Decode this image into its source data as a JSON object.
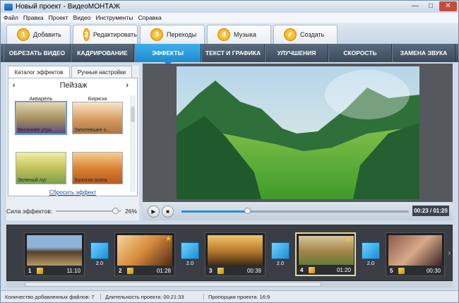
{
  "window": {
    "title": "Новый проект - ВидеоМОНТАЖ",
    "min": "—",
    "max": "□",
    "close": "✕"
  },
  "menu": [
    "Файл",
    "Правка",
    "Проект",
    "Видео",
    "Инструменты",
    "Справка"
  ],
  "steps": [
    {
      "num": "1",
      "label": "Добавить"
    },
    {
      "num": "2",
      "label": "Редактировать"
    },
    {
      "num": "3",
      "label": "Переходы"
    },
    {
      "num": "4",
      "label": "Музыка"
    },
    {
      "num": "✓",
      "label": "Создать"
    }
  ],
  "tabs": [
    "ОБРЕЗАТЬ ВИДЕО",
    "КАДРИРОВАНИЕ",
    "ЭФФЕКТЫ",
    "ТЕКСТ И ГРАФИКА",
    "УЛУЧШЕНИЯ",
    "СКОРОСТЬ",
    "ЗАМЕНА ЗВУКА"
  ],
  "active_tab": "ЭФФЕКТЫ",
  "left_panel": {
    "tabs": [
      "Каталог эффектов",
      "Ручные настройки"
    ],
    "category": "Пейзаж",
    "prev": "‹",
    "next": "›",
    "effects": [
      {
        "caption": "Акварель",
        "name": "Весеннее утро"
      },
      {
        "caption": "Бирюза",
        "name": "Запотевшее о..."
      },
      {
        "caption": "",
        "name": "Зеленый луг"
      },
      {
        "caption": "",
        "name": "Золотая осень"
      }
    ],
    "reset": "Сбросить эффект"
  },
  "strength": {
    "label": "Сила эффектов:",
    "value": "26%",
    "fraction": 0.87
  },
  "player": {
    "time": "00:23 / 01:20",
    "progress": 0.29,
    "play": "▶",
    "stop": "■"
  },
  "timeline": {
    "clips": [
      {
        "index": "1",
        "duration": "11:10",
        "star": false
      },
      {
        "index": "2",
        "duration": "01:28",
        "star": true
      },
      {
        "index": "3",
        "duration": "00:39",
        "star": false
      },
      {
        "index": "4",
        "duration": "01:20",
        "star": true
      },
      {
        "index": "5",
        "duration": "00:30",
        "star": false
      }
    ],
    "transitions": [
      "2.0",
      "2.0",
      "2.0",
      "2.0"
    ],
    "next": "›"
  },
  "status": {
    "files": "Количество добавленных файлов: 7",
    "duration": "Длительность проекта:  00:21:33",
    "ratio": "Пропорции проекта:  16:9"
  }
}
